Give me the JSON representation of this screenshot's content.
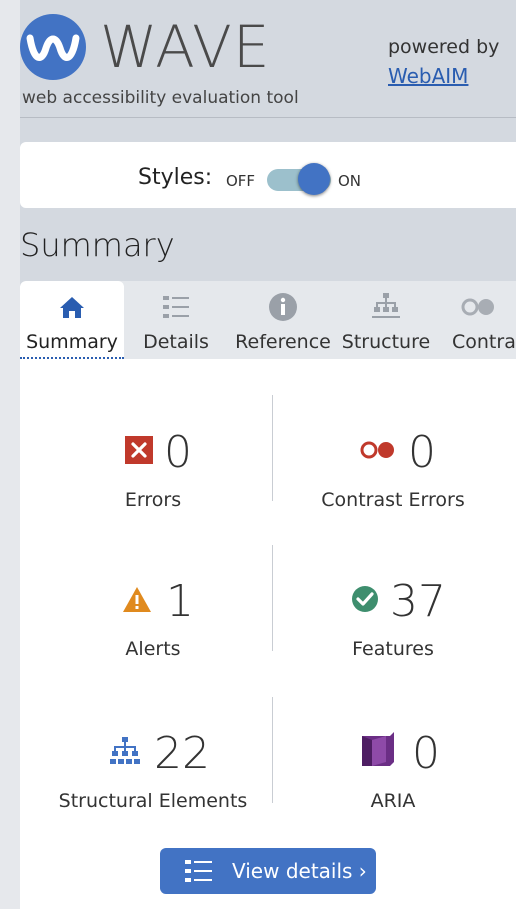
{
  "header": {
    "logo_text": "WAVE",
    "tagline": "web accessibility evaluation tool",
    "powered_by": "powered by",
    "webaim_link": "WebAIM"
  },
  "styles_toggle": {
    "label": "Styles:",
    "off_label": "OFF",
    "on_label": "ON",
    "state": "on"
  },
  "page_title": "Summary",
  "tabs": [
    {
      "label": "Summary",
      "icon": "home-icon",
      "active": true
    },
    {
      "label": "Details",
      "icon": "list-icon",
      "active": false
    },
    {
      "label": "Reference",
      "icon": "info-icon",
      "active": false
    },
    {
      "label": "Structure",
      "icon": "hierarchy-icon",
      "active": false
    },
    {
      "label": "Contrast",
      "icon": "contrast-icon",
      "active": false
    }
  ],
  "summary": {
    "errors": {
      "count": "0",
      "label": "Errors",
      "icon": "error-icon"
    },
    "contrast_errors": {
      "count": "0",
      "label": "Contrast Errors",
      "icon": "contrast-error-icon"
    },
    "alerts": {
      "count": "1",
      "label": "Alerts",
      "icon": "alert-icon"
    },
    "features": {
      "count": "37",
      "label": "Features",
      "icon": "feature-check-icon"
    },
    "structural": {
      "count": "22",
      "label": "Structural Elements",
      "icon": "structure-icon"
    },
    "aria": {
      "count": "0",
      "label": "ARIA",
      "icon": "aria-icon"
    }
  },
  "view_details": {
    "label": "View details ›",
    "icon": "list-icon"
  },
  "colors": {
    "brand_blue": "#4273c4",
    "error_red": "#c0392b",
    "alert_orange": "#e08a1e",
    "feature_green": "#3e8e6e",
    "aria_purple": "#6b2e85",
    "background": "#d4d9e0"
  }
}
